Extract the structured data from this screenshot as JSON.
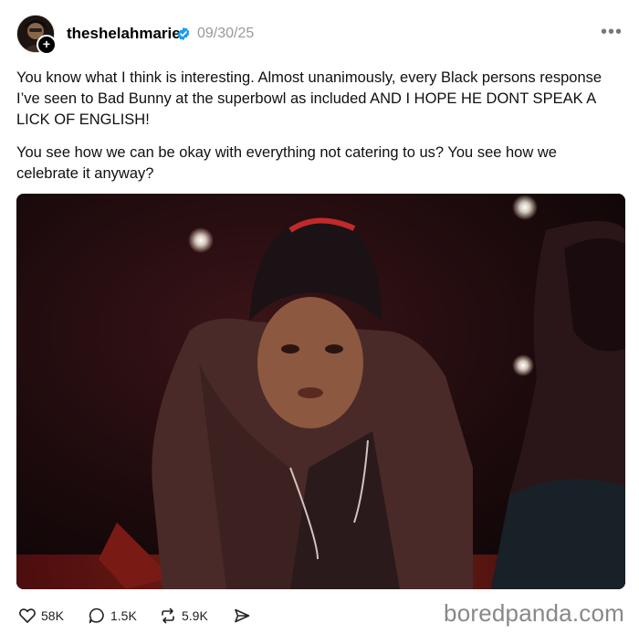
{
  "post": {
    "username": "theshelahmarie",
    "date": "09/30/25",
    "paragraphs": [
      "You know what I think is interesting. Almost unanimously, every Black persons response I’ve seen to Bad Bunny at the superbowl as included AND I HOPE HE DONT SPEAK A LICK OF ENGLISH!",
      "You see how we can be okay with everything not catering to us? You see how we celebrate it anyway?"
    ],
    "image_alt": "Still of a person in a beanie and hoodie leaning forward",
    "stats": {
      "likes": "58K",
      "replies": "1.5K",
      "reposts": "5.9K"
    }
  },
  "watermark": "boredpanda.com",
  "colors": {
    "verified": "#1d9bf0",
    "muted": "#999999",
    "text": "#101010"
  },
  "icons": [
    "follow-plus-icon",
    "verified-icon",
    "more-icon",
    "heart-icon",
    "reply-icon",
    "repost-icon",
    "share-icon"
  ]
}
